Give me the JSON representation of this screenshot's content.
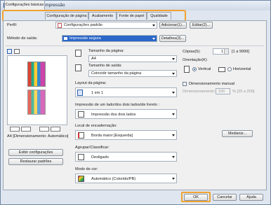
{
  "window": {
    "title": "Preferências de Impressão"
  },
  "tabs": [
    {
      "label": "Configurações básicas"
    },
    {
      "label": "Configuração de página"
    },
    {
      "label": "Acabamento"
    },
    {
      "label": "Fonte de papel"
    },
    {
      "label": "Qualidade"
    }
  ],
  "profile": {
    "label": "Perfil:",
    "value": "Configurações padrão",
    "add_button": "Adicionar(1)...",
    "edit_button": "Editar(2)..."
  },
  "output_method": {
    "label": "Método de saída:",
    "value": "Impressão segura",
    "details_button": "Detalhes(3)..."
  },
  "preview": {
    "caption": "A4 [Dimensionamento: Automático]",
    "settings_button": "Exibir configurações",
    "restore_button": "Restaurar padrões"
  },
  "page_size": {
    "label": "Tamanho da página:",
    "value": "A4"
  },
  "output_size": {
    "label": "Tamanho de saída:",
    "value": "Coincidir tamanho da página"
  },
  "copies": {
    "label": "Cópias(5):",
    "value": "1",
    "range": "[1 a 9999]"
  },
  "orientation": {
    "label": "Orientação(K)",
    "options": [
      "Vertical",
      "Horizontal"
    ],
    "selected": "Vertical"
  },
  "layout": {
    "label": "Layout da página:",
    "value": "1 em 1"
  },
  "manual_scaling": {
    "label": "Dimensionamento manual",
    "field_label": "Dimensionamento:",
    "value": "100",
    "range": "% [25 a 200]"
  },
  "duplex": {
    "label": "Impressão de um lado/dos dois lados/de livreto :",
    "value": "Impressão dos dois lados"
  },
  "binding": {
    "label": "Local de encadernação:",
    "value": "Borda maior [Esquerda]",
    "margin_button": "Medianiz..."
  },
  "collate": {
    "label": "Agrupar/Classificar:",
    "value": "Desligado"
  },
  "color_mode": {
    "label": "Modo de cor:",
    "value": "Automático (Colorido/PB)"
  },
  "footer": {
    "ok": "OK",
    "cancel": "Cancelar",
    "help": "Ajuda"
  },
  "colors": {
    "highlight": "#f0a230",
    "accent": "#2a5cad"
  }
}
